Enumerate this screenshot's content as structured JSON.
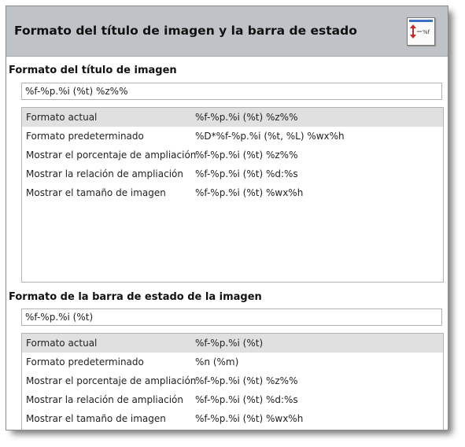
{
  "header": {
    "title": "Formato del título de imagen y la barra de estado",
    "help_icon": "help-format-icon"
  },
  "title_section": {
    "heading": "Formato del título de imagen",
    "input_value": "%f-%p.%i (%t) %z%%",
    "rows": [
      {
        "label": "Formato actual",
        "value": "%f-%p.%i (%t) %z%%"
      },
      {
        "label": "Formato predeterminado",
        "value": "%D*%f-%p.%i (%t, %L) %wx%h"
      },
      {
        "label": "Mostrar el porcentaje de ampliación",
        "value": "%f-%p.%i (%t) %z%%"
      },
      {
        "label": "Mostrar la relación de ampliación",
        "value": "%f-%p.%i (%t) %d:%s"
      },
      {
        "label": "Mostrar el tamaño de imagen",
        "value": "%f-%p.%i (%t) %wx%h"
      }
    ]
  },
  "status_section": {
    "heading": "Formato de la barra de estado de la imagen",
    "input_value": "%f-%p.%i (%t)",
    "rows": [
      {
        "label": "Formato actual",
        "value": "%f-%p.%i (%t)"
      },
      {
        "label": "Formato predeterminado",
        "value": "%n (%m)"
      },
      {
        "label": "Mostrar el porcentaje de ampliación",
        "value": "%f-%p.%i (%t) %z%%"
      },
      {
        "label": "Mostrar la relación de ampliación",
        "value": "%f-%p.%i (%t) %d:%s"
      },
      {
        "label": "Mostrar el tamaño de imagen",
        "value": "%f-%p.%i (%t) %wx%h"
      }
    ]
  }
}
